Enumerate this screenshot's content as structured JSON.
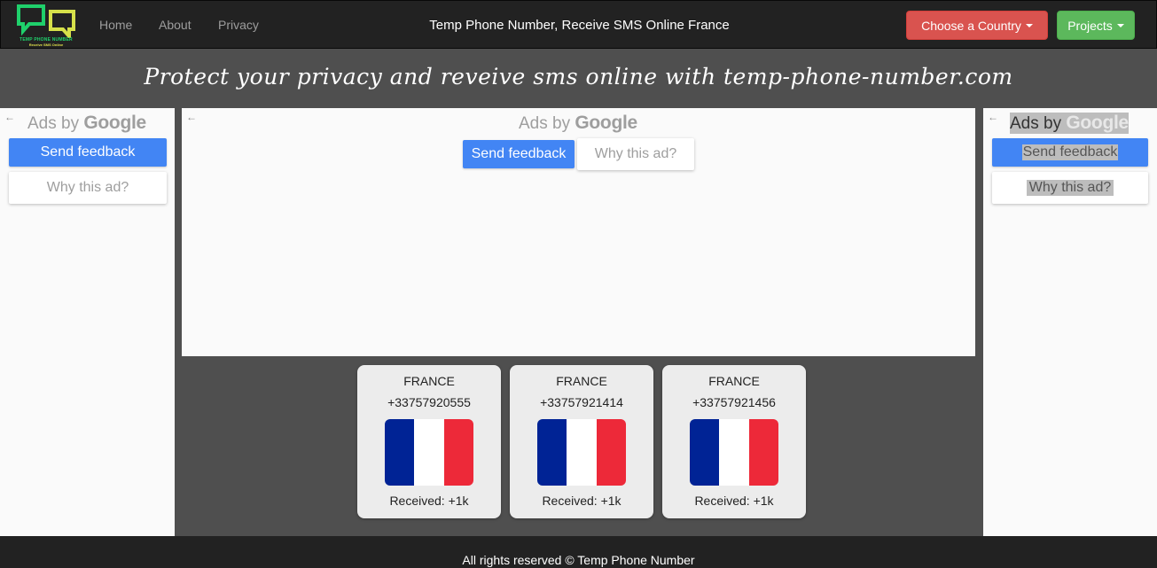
{
  "navbar": {
    "logo": {
      "line1": "TEMP PHONE NUMBER",
      "line2": "Receive SMS Online"
    },
    "links": [
      "Home",
      "About",
      "Privacy"
    ],
    "title": "Temp Phone Number, Receive SMS Online France",
    "choose_country": "Choose a Country",
    "projects": "Projects"
  },
  "tagline": "Protect your privacy and reveive sms online with temp-phone-number.com",
  "ads": {
    "back_arrow": "←",
    "ads_by": "Ads by",
    "google": "Google",
    "send_feedback": "Send feedback",
    "why_this_ad": "Why this ad?"
  },
  "cards": [
    {
      "country": "FRANCE",
      "number": "+33757920555",
      "received": "Received: +1k"
    },
    {
      "country": "FRANCE",
      "number": "+33757921414",
      "received": "Received: +1k"
    },
    {
      "country": "FRANCE",
      "number": "+33757921456",
      "received": "Received: +1k"
    }
  ],
  "flag_colors": [
    "#002395",
    "#ffffff",
    "#ed2939"
  ],
  "footer": "All rights reserved © Temp Phone Number"
}
